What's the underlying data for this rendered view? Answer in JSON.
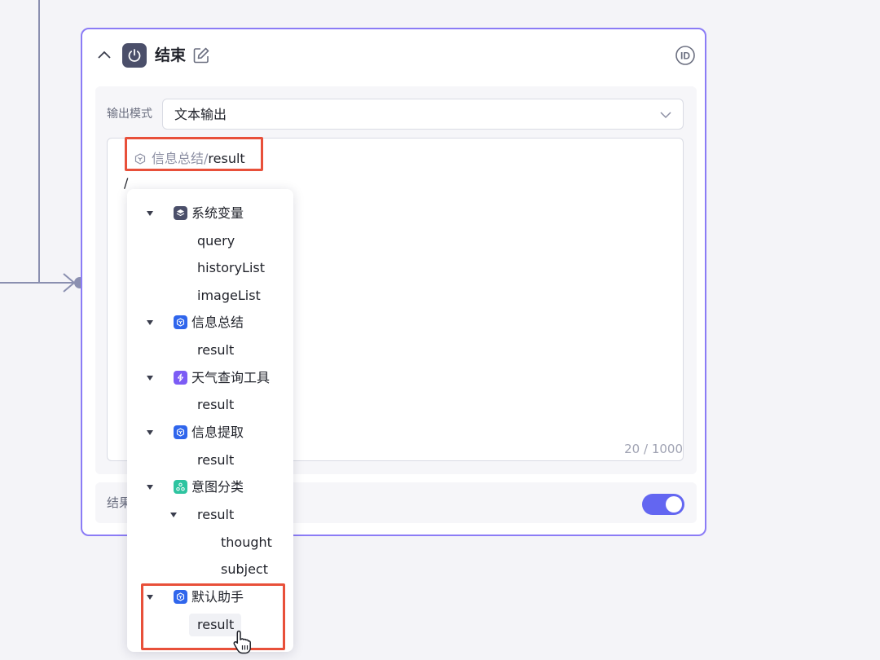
{
  "node": {
    "title": "结束",
    "output_mode_label": "输出模式",
    "output_mode_value": "文本输出",
    "editor": {
      "variable_node": "信息总结",
      "variable_separator": "/",
      "variable_field": "result",
      "typed_text": "/",
      "counter": "20 / 1000"
    },
    "result_label": "结果",
    "toggle_on": true
  },
  "variable_tree": {
    "groups": [
      {
        "label": "系统变量",
        "icon": "layers-icon",
        "color": "#4b4f6a",
        "children": [
          "query",
          "historyList",
          "imageList"
        ]
      },
      {
        "label": "信息总结",
        "icon": "cube-icon",
        "color": "#3066ec",
        "children": [
          "result"
        ]
      },
      {
        "label": "天气查询工具",
        "icon": "bolt-icon",
        "color": "#7c5cf5",
        "children": [
          "result"
        ]
      },
      {
        "label": "信息提取",
        "icon": "cube-icon",
        "color": "#3066ec",
        "children": [
          "result"
        ]
      },
      {
        "label": "意图分类",
        "icon": "share-icon",
        "color": "#2ec4a0",
        "children": [
          {
            "label": "result",
            "children": [
              "thought",
              "subject"
            ]
          }
        ]
      },
      {
        "label": "默认助手",
        "icon": "cube-icon",
        "color": "#3066ec",
        "children": [
          "result"
        ]
      }
    ]
  },
  "colors": {
    "accent": "#6366f1",
    "node_border": "#8b7cf6",
    "highlight": "#e8503a"
  }
}
